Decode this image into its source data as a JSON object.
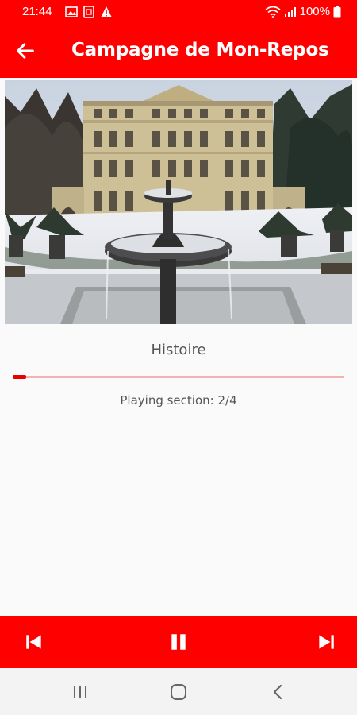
{
  "status_bar": {
    "time": "21:44",
    "battery": "100%",
    "icons": [
      "image-icon",
      "screenshot-icon",
      "warning-icon",
      "wifi-icon",
      "signal-icon",
      "battery-icon"
    ]
  },
  "toolbar": {
    "title": "Campagne de Mon-Repos",
    "back_icon": "arrow-left-icon"
  },
  "colors": {
    "accent": "#ff0000",
    "progress_fill": "#e60000",
    "progress_track": "#f6b2b2",
    "background": "#fafafa"
  },
  "main": {
    "section_title": "Histoire",
    "progress": 0.04,
    "playing_text": "Playing section: 2/4"
  },
  "player": {
    "controls": [
      "skip-previous-icon",
      "pause-icon",
      "skip-next-icon"
    ]
  },
  "nav": {
    "buttons": [
      "recent-apps-icon",
      "home-icon",
      "back-icon"
    ]
  }
}
